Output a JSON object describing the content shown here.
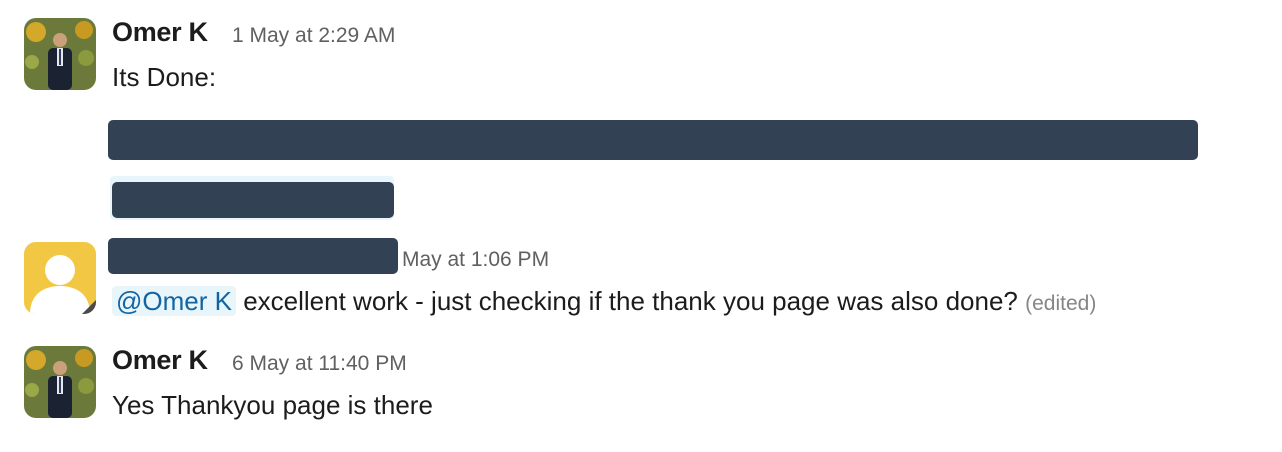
{
  "messages": [
    {
      "author": "Omer K",
      "time": "1 May at 2:29 AM",
      "text": "Its Done:",
      "avatar": "photo-avatar"
    },
    {
      "time": "May at 1:06 PM",
      "mention": "@Omer K",
      "text": "excellent work - just checking if the thank you page was also done?",
      "edited": "(edited)",
      "avatar": "default-user-avatar"
    },
    {
      "author": "Omer K",
      "time": "6 May at 11:40 PM",
      "text": "Yes Thankyou page is there",
      "avatar": "photo-avatar"
    }
  ],
  "colors": {
    "redaction": "#334155",
    "mention_bg": "#e8f5fa",
    "mention_text": "#1264a3",
    "default_avatar_bg": "#f2c744"
  }
}
